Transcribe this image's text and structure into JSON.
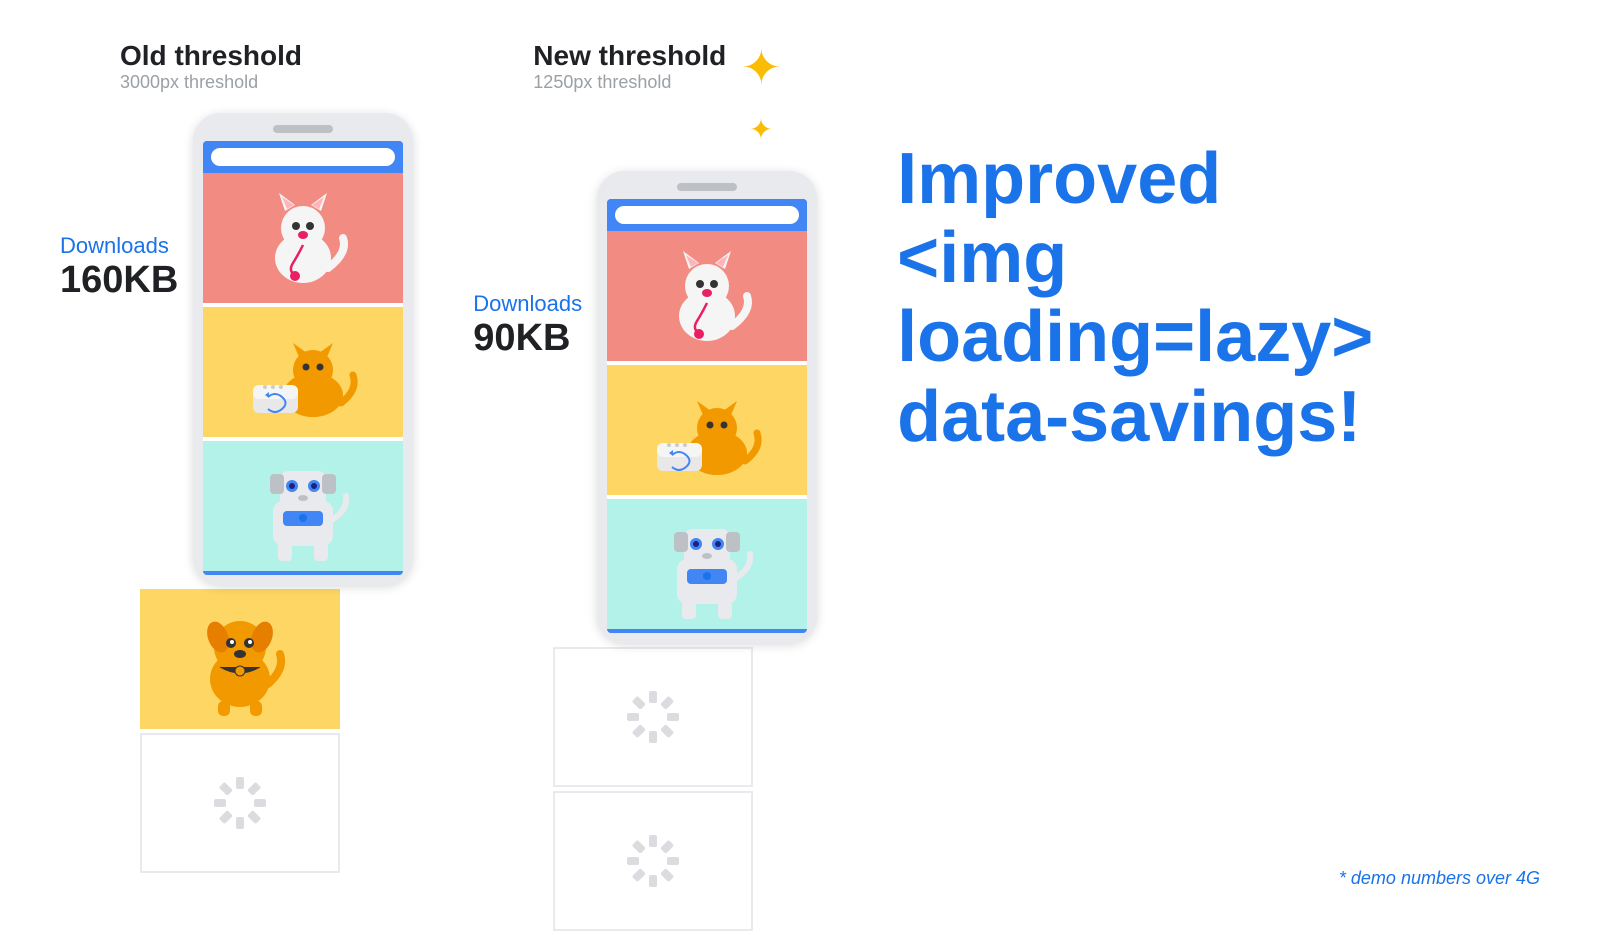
{
  "old_threshold": {
    "title": "Old threshold",
    "subtitle": "3000px threshold",
    "downloads_label": "Downloads",
    "download_size": "160KB"
  },
  "new_threshold": {
    "title": "New threshold",
    "subtitle": "1250px threshold",
    "downloads_label": "Downloads",
    "download_size": "90KB"
  },
  "right_content": {
    "line1": "Improved",
    "line2": "<img loading=lazy>",
    "line3": "data-savings!"
  },
  "demo_note": "* demo numbers over 4G",
  "loading_text": "loading",
  "sparkle_icon": "✦"
}
